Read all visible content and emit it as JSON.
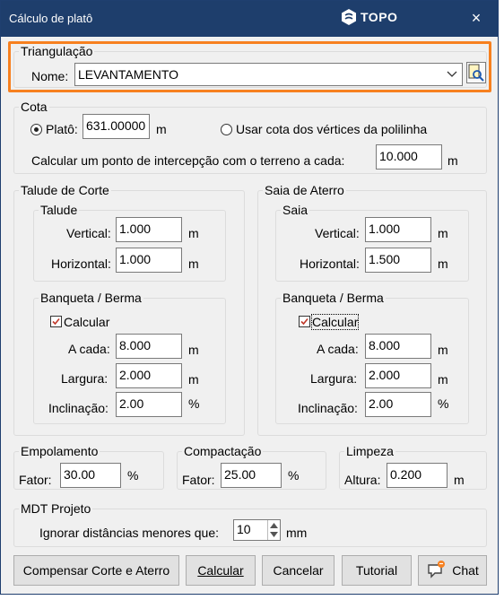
{
  "window": {
    "title": "Cálculo de platô",
    "logo_text": "TOPO",
    "close_glyph": "×"
  },
  "triangulacao": {
    "legend": "Triangulação",
    "nome_label": "Nome:",
    "nome_value": "LEVANTAMENTO",
    "highlight_color": "#f7801f"
  },
  "cota": {
    "legend": "Cota",
    "plato_label": "Platô:",
    "plato_value": "631.00000",
    "plato_unit": "m",
    "usar_label": "Usar cota dos vértices da polilinha",
    "calcular_label": "Calcular um ponto de intercepção com o terreno a cada:",
    "calcular_value": "10.000",
    "calcular_unit": "m"
  },
  "talude_corte": {
    "legend": "Talude de Corte",
    "talude": {
      "legend": "Talude",
      "vertical_label": "Vertical:",
      "vertical_value": "1.000",
      "vertical_unit": "m",
      "horizontal_label": "Horizontal:",
      "horizontal_value": "1.000",
      "horizontal_unit": "m"
    },
    "banqueta": {
      "legend": "Banqueta / Berma",
      "calcular_label": "Calcular",
      "acada_label": "A cada:",
      "acada_value": "8.000",
      "acada_unit": "m",
      "largura_label": "Largura:",
      "largura_value": "2.000",
      "largura_unit": "m",
      "inclinacao_label": "Inclinação:",
      "inclinacao_value": "2.00",
      "inclinacao_unit": "%"
    }
  },
  "saia_aterro": {
    "legend": "Saia de Aterro",
    "saia": {
      "legend": "Saia",
      "vertical_label": "Vertical:",
      "vertical_value": "1.000",
      "vertical_unit": "m",
      "horizontal_label": "Horizontal:",
      "horizontal_value": "1.500",
      "horizontal_unit": "m"
    },
    "banqueta": {
      "legend": "Banqueta / Berma",
      "calcular_label": "Calcular",
      "acada_label": "A cada:",
      "acada_value": "8.000",
      "acada_unit": "m",
      "largura_label": "Largura:",
      "largura_value": "2.000",
      "largura_unit": "m",
      "inclinacao_label": "Inclinação:",
      "inclinacao_value": "2.00",
      "inclinacao_unit": "%"
    }
  },
  "empolamento": {
    "legend": "Empolamento",
    "fator_label": "Fator:",
    "fator_value": "30.00",
    "fator_unit": "%"
  },
  "compactacao": {
    "legend": "Compactação",
    "fator_label": "Fator:",
    "fator_value": "25.00",
    "fator_unit": "%"
  },
  "limpeza": {
    "legend": "Limpeza",
    "altura_label": "Altura:",
    "altura_value": "0.200",
    "altura_unit": "m"
  },
  "mdt": {
    "legend": "MDT Projeto",
    "ignorar_label": "Ignorar distâncias menores que:",
    "ignorar_value": "10",
    "ignorar_unit": "mm"
  },
  "buttons": {
    "compensar": "Compensar Corte e Aterro",
    "calcular": "Calcular",
    "cancelar": "Cancelar",
    "tutorial": "Tutorial",
    "chat": "Chat"
  }
}
